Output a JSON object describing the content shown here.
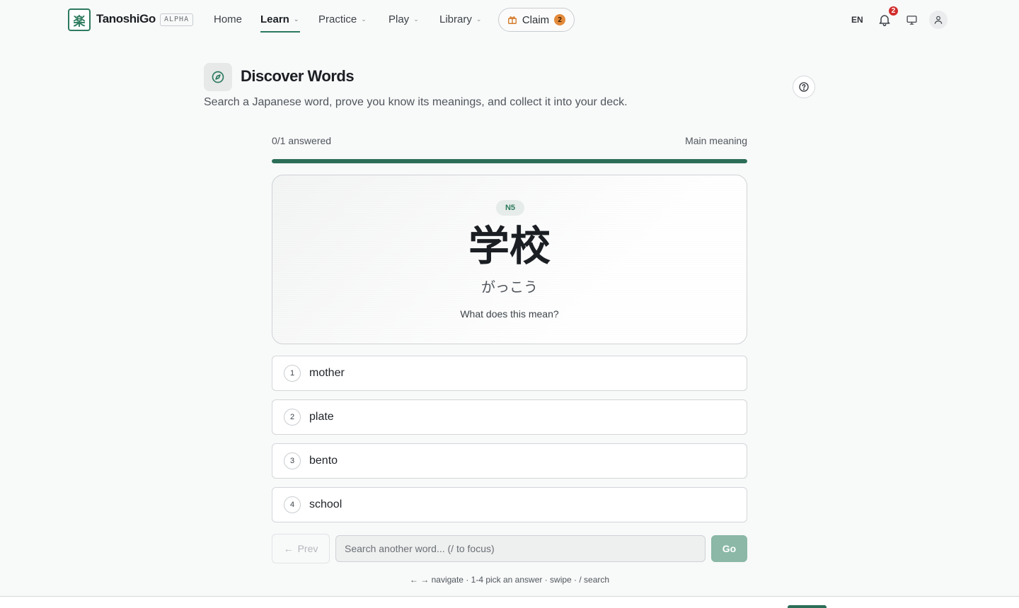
{
  "app": {
    "brand": "TanoshiGo",
    "badge": "ALPHA",
    "logo_glyph": "楽"
  },
  "nav": {
    "items": [
      {
        "label": "Home",
        "dropdown": false,
        "active": false
      },
      {
        "label": "Learn",
        "dropdown": true,
        "active": true
      },
      {
        "label": "Practice",
        "dropdown": true,
        "active": false
      },
      {
        "label": "Play",
        "dropdown": true,
        "active": false
      },
      {
        "label": "Library",
        "dropdown": true,
        "active": false
      }
    ],
    "claim": {
      "label": "Claim",
      "count": "2"
    },
    "language": "EN",
    "notifications_count": "2"
  },
  "header": {
    "title": "Discover Words",
    "subtitle": "Search a Japanese word, prove you know its meanings, and collect it into your deck."
  },
  "progress": {
    "answered_label": "0/1 answered",
    "mode_label": "Main meaning",
    "fill_fraction": 1.0
  },
  "card": {
    "level": "N5",
    "word": "学校",
    "reading": "がっこう",
    "prompt": "What does this mean?"
  },
  "options": [
    {
      "num": "1",
      "text": "mother"
    },
    {
      "num": "2",
      "text": "plate"
    },
    {
      "num": "3",
      "text": "bento"
    },
    {
      "num": "4",
      "text": "school"
    }
  ],
  "search": {
    "prev_label": "Prev",
    "placeholder": "Search another word... (/ to focus)",
    "go_label": "Go"
  },
  "hint": "navigate · 1-4 pick an answer · swipe · / search",
  "colors": {
    "accent": "#2c7a5d",
    "progress": "#2c6e58",
    "go_button": "#8bb8a7",
    "claim_badge": "#e48a3b",
    "notification_badge": "#d22e2e"
  }
}
